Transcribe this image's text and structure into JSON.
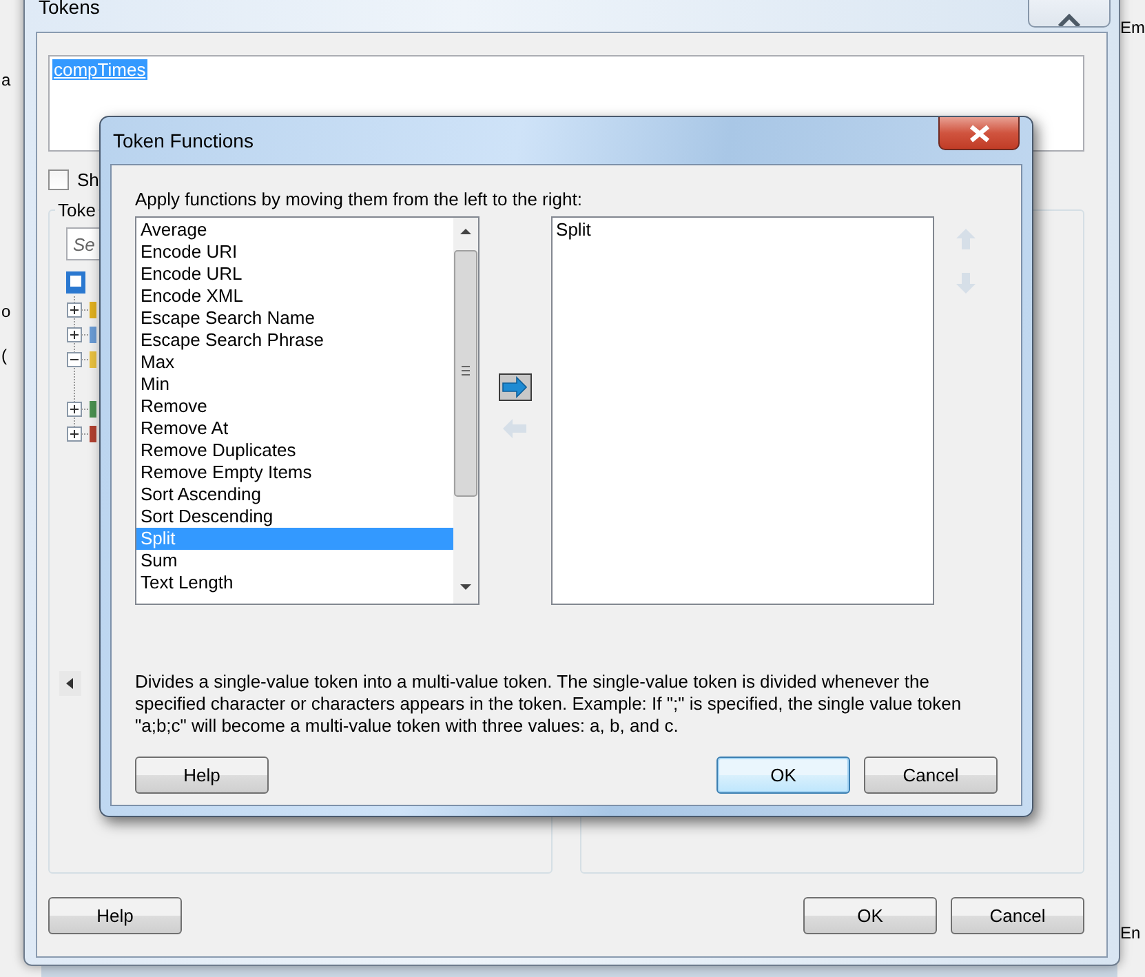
{
  "background_window": {
    "title": "Tokens",
    "token_text": "compTimes",
    "checkbox": {
      "label": "Sh",
      "checked": false
    },
    "group_label": "Toke",
    "search": {
      "placeholder": "Se"
    },
    "buttons": [
      {
        "label": "Help",
        "kind": "left"
      },
      {
        "label": "OK",
        "kind": "right"
      },
      {
        "label": "Cancel",
        "kind": "right"
      }
    ]
  },
  "side_fragments": {
    "left": [
      "a",
      "o",
      "("
    ],
    "right": [
      "Em",
      "En"
    ]
  },
  "dialog": {
    "title": "Token Functions",
    "instruction": "Apply functions by moving them from the left to the right:",
    "available": [
      {
        "label": "Average",
        "selected": false
      },
      {
        "label": "Encode URI",
        "selected": false
      },
      {
        "label": "Encode URL",
        "selected": false
      },
      {
        "label": "Encode XML",
        "selected": false
      },
      {
        "label": "Escape Search Name",
        "selected": false
      },
      {
        "label": "Escape Search Phrase",
        "selected": false
      },
      {
        "label": "Max",
        "selected": false
      },
      {
        "label": "Min",
        "selected": false
      },
      {
        "label": "Remove",
        "selected": false
      },
      {
        "label": "Remove At",
        "selected": false
      },
      {
        "label": "Remove Duplicates",
        "selected": false
      },
      {
        "label": "Remove Empty Items",
        "selected": false
      },
      {
        "label": "Sort Ascending",
        "selected": false
      },
      {
        "label": "Sort Descending",
        "selected": false
      },
      {
        "label": "Split",
        "selected": true
      },
      {
        "label": "Sum",
        "selected": false
      },
      {
        "label": "Text Length",
        "selected": false
      }
    ],
    "applied": [
      {
        "label": "Split",
        "selected": false
      }
    ],
    "move_controls": [
      {
        "kind": "add",
        "disabled": false
      },
      {
        "kind": "remove",
        "disabled": true
      }
    ],
    "order_controls": [
      {
        "kind": "up",
        "disabled": true
      },
      {
        "kind": "down",
        "disabled": true
      }
    ],
    "description": "Divides a single-value token into a multi-value token. The single-value token is divided whenever the specified character or characters appears in the token. Example: If \";\" is specified, the single value token \"a;b;c\" will become a multi-value token with three values: a, b, and c.",
    "buttons": [
      {
        "label": "Help",
        "kind": "left",
        "default": false
      },
      {
        "label": "OK",
        "kind": "right",
        "default": true
      },
      {
        "label": "Cancel",
        "kind": "right",
        "default": false
      }
    ]
  }
}
